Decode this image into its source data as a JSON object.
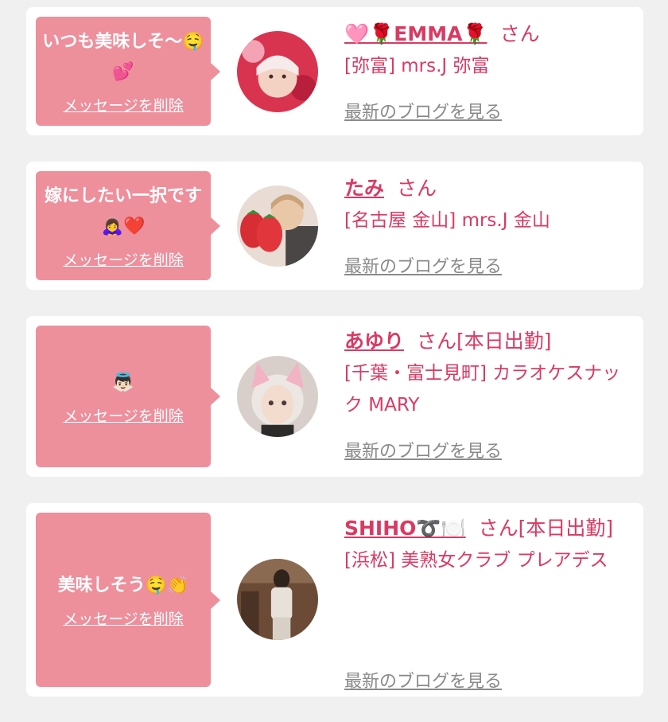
{
  "colors": {
    "background": "#f1f0f0",
    "card": "#ffffff",
    "bubble": "#ee8f9c",
    "name": "#d93a63",
    "blog_link": "#8a8a8a"
  },
  "entries": [
    {
      "message": "いつも美味しそ〜🤤💕",
      "delete_label": "メッセージを削除",
      "name": "🩷🌹EMMA🌹",
      "honorific": "さん",
      "shop": "[弥富] mrs.J 弥富",
      "blog_label": "最新のブログを見る"
    },
    {
      "message": "嫁にしたい一択です🙇‍♀️❤️",
      "delete_label": "メッセージを削除",
      "name": "たみ",
      "honorific": "さん",
      "shop": "[名古屋 金山] mrs.J 金山",
      "blog_label": "最新のブログを見る"
    },
    {
      "message": "👼🏻",
      "delete_label": "メッセージを削除",
      "name": "あゆり",
      "honorific": "さん[本日出勤]",
      "shop": "[千葉・富士見町] カラオケスナック MARY",
      "blog_label": "最新のブログを見る"
    },
    {
      "message": "美味しそう🤤👏",
      "delete_label": "メッセージを削除",
      "name": "SHIHO➰🍽️",
      "honorific": "さん[本日出勤]",
      "shop": "[浜松] 美熟女クラブ プレアデス",
      "blog_label": "最新のブログを見る"
    }
  ]
}
